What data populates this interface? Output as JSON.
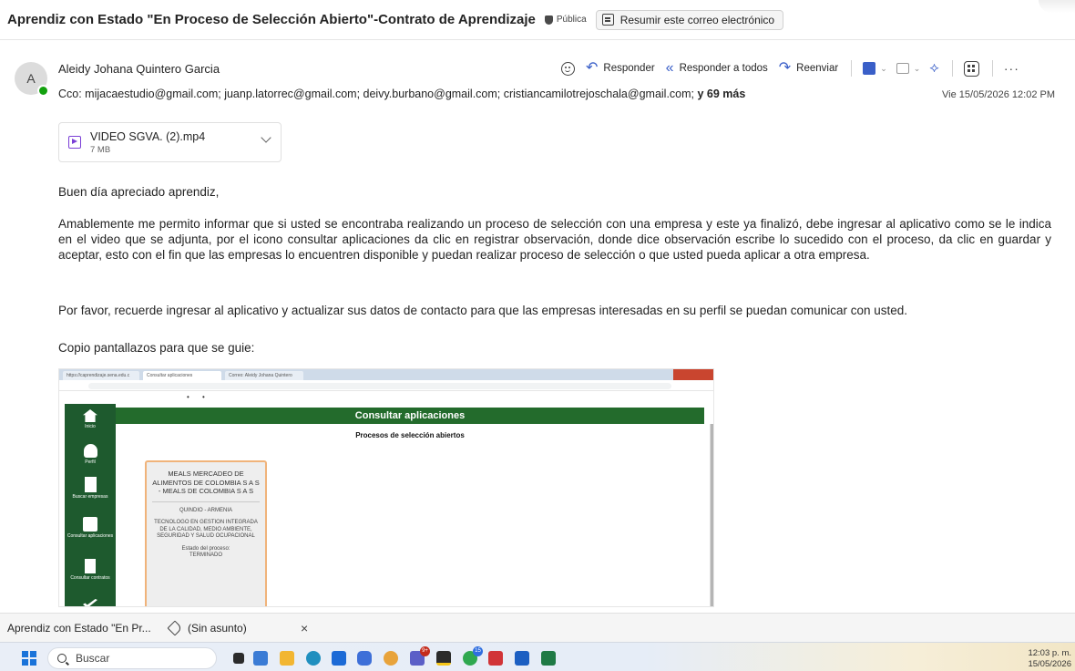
{
  "email": {
    "subject": "Aprendiz con Estado \"En Proceso de Selección Abierto\"-Contrato de Aprendizaje",
    "visibility": "Pública",
    "summarize_label": "Resumir este correo electrónico",
    "avatar_initial": "A",
    "sender": "Aleidy Johana Quintero Garcia",
    "cc_text": "Cco: mijacaestudio@gmail.com;  juanp.latorrec@gmail.com;  deivy.burbano@gmail.com;  cristiancamilotrejoschala@gmail.com;",
    "cc_more": "y 69 más",
    "date": "Vie 15/05/2026 12:02 PM",
    "actions": {
      "reply": "Responder",
      "reply_all": "Responder a todos",
      "forward": "Reenviar",
      "more": "···"
    },
    "attachment": {
      "name": "VIDEO SGVA. (2).mp4",
      "size": "7 MB"
    },
    "body": {
      "greeting": "Buen día apreciado aprendiz,",
      "paragraph1": "Amablemente me permito informar que si usted se encontraba realizando un proceso de selección con una empresa y este ya finalizó, debe ingresar al aplicativo como se le indica en el video que se adjunta, por el icono consultar aplicaciones da clic en registrar observación, donde dice observación escribe lo sucedido con el proceso, da clic en guardar y aceptar, esto con el fin que las empresas lo encuentren disponible y puedan realizar proceso de selección o que usted pueda aplicar a otra empresa.",
      "paragraph2": "Por favor, recuerde ingresar al aplicativo y actualizar sus datos de contacto para que las empresas interesadas en su perfil se puedan comunicar con usted.",
      "paragraph3": "Copio pantallazos para que se guie:"
    }
  },
  "embedded_screenshot": {
    "tabs": [
      "https://caprendizaje.sena.edu.c",
      "Consultar aplicaciones",
      "Correo: Aleidy Johana Quintero"
    ],
    "page_header": "Consultar aplicaciones",
    "section_title": "Procesos de selección abiertos",
    "sidebar": [
      {
        "label": "Inicio",
        "icon": "home-icon"
      },
      {
        "label": "Perfil",
        "icon": "user-icon"
      },
      {
        "label": "Buscar empresas",
        "icon": "building-icon"
      },
      {
        "label": "Consultar aplicaciones",
        "icon": "applications-icon"
      },
      {
        "label": "Consultar contratos",
        "icon": "document-icon"
      }
    ],
    "card": {
      "company": "MEALS MERCADEO DE ALIMENTOS DE COLOMBIA S A S - MEALS DE COLOMBIA S A S",
      "location": "QUINDIO - ARMENIA",
      "program": "TECNOLOGO EN GESTION INTEGRADA DE LA CALIDAD, MEDIO AMBIENTE, SEGURIDAD Y SALUD OCUPACIONAL",
      "status_label": "Estado del proceso:",
      "status_value": "TERMINADO"
    }
  },
  "status_tabs": {
    "tab1": "Aprendiz con Estado \"En Pr...",
    "tab2": "(Sin asunto)",
    "close": "×"
  },
  "taskbar": {
    "search_placeholder": "Buscar",
    "badge_teams": "9+",
    "badge_whatsapp": "15",
    "time": "12:03 p. m.",
    "date": "15/05/2026"
  },
  "colors": {
    "accent_blue": "#3a5fc8",
    "presence_green": "#13a10e",
    "sena_green": "#236b2c",
    "card_border": "#f0b37a"
  }
}
